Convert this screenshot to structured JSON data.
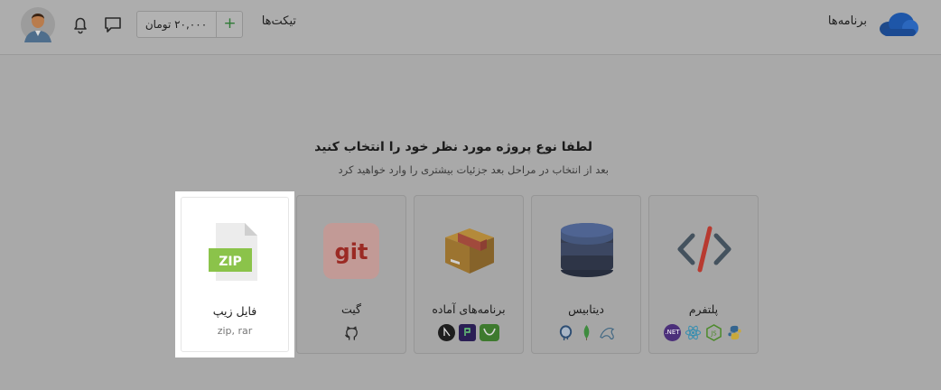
{
  "header": {
    "apps_label": "برنامه‌ها",
    "tickets_label": "تیکت‌ها",
    "wallet_amount": "۲۰,۰۰۰ تومان",
    "wallet_add": "+",
    "icons": [
      "cloud-logo",
      "plus-icon",
      "bell-icon",
      "chat-icon",
      "avatar"
    ]
  },
  "main": {
    "title": "لطفا نوع پروژه مورد نظر خود را انتخاب کنید",
    "subtitle": "بعد از انتخاب در مراحل بعد جزئیات بیشتری را وارد خواهید کرد"
  },
  "cards": [
    {
      "label": "پلتفرم",
      "icon": "code-icon",
      "tech": [
        "python",
        "nodejs",
        "react",
        ".NET"
      ]
    },
    {
      "label": "دیتابیس",
      "icon": "database-icon",
      "tech": [
        "mysql",
        "mongodb",
        "postgresql"
      ]
    },
    {
      "label": "برنامه‌های آماده",
      "icon": "box-icon",
      "tech": [
        "nginx",
        "pydio",
        "nextjs"
      ]
    },
    {
      "label": "گیت",
      "icon": "git-icon",
      "icon_text": "git",
      "tech": [
        "github"
      ]
    },
    {
      "label": "فایل زیپ",
      "icon": "zip-file-icon",
      "icon_text": "ZIP",
      "sub": "zip, rar",
      "selected": true
    }
  ],
  "colors": {
    "overlay_bg": "#a9a9a9",
    "selected_card_bg": "#ffffff",
    "zip_green": "#8bc34a",
    "git_red": "#f05033"
  }
}
